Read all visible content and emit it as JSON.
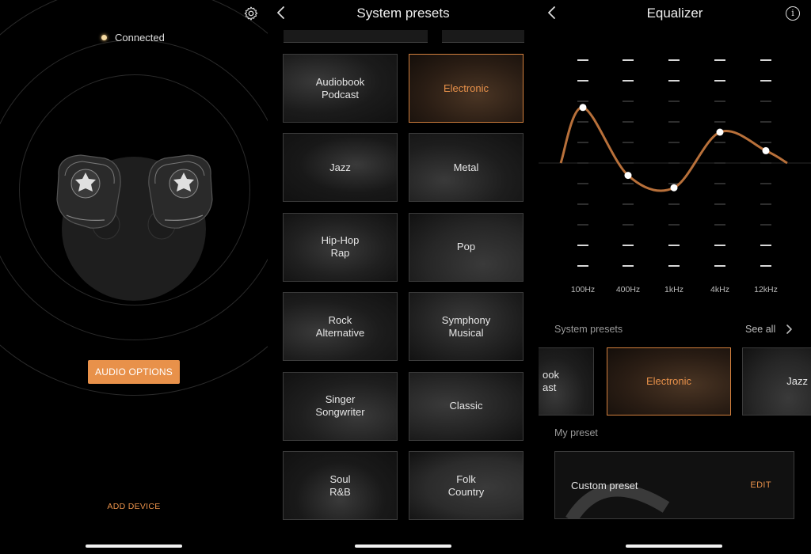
{
  "device": {
    "status": "Connected",
    "audio_options_label": "AUDIO OPTIONS",
    "add_device_label": "ADD DEVICE"
  },
  "presets_screen": {
    "title": "System presets",
    "presets": [
      {
        "label": "Audiobook\nPodcast",
        "selected": false
      },
      {
        "label": "Electronic",
        "selected": true
      },
      {
        "label": "Jazz",
        "selected": false
      },
      {
        "label": "Metal",
        "selected": false
      },
      {
        "label": "Hip-Hop\nRap",
        "selected": false
      },
      {
        "label": "Pop",
        "selected": false
      },
      {
        "label": "Rock\nAlternative",
        "selected": false
      },
      {
        "label": "Symphony\nMusical",
        "selected": false
      },
      {
        "label": "Singer\nSongwriter",
        "selected": false
      },
      {
        "label": "Classic",
        "selected": false
      },
      {
        "label": "Soul\nR&B",
        "selected": false
      },
      {
        "label": "Folk\nCountry",
        "selected": false
      }
    ]
  },
  "equalizer": {
    "title": "Equalizer",
    "bands": [
      {
        "freq": "100Hz",
        "level": 0.77
      },
      {
        "freq": "400Hz",
        "level": 0.44
      },
      {
        "freq": "1kHz",
        "level": 0.38
      },
      {
        "freq": "4kHz",
        "level": 0.65
      },
      {
        "freq": "12kHz",
        "level": 0.56
      }
    ],
    "system_presets_label": "System presets",
    "see_all_label": "See all",
    "carousel": [
      {
        "label": "ook\nast",
        "selected": false
      },
      {
        "label": "Electronic",
        "selected": true
      },
      {
        "label": "Jazz",
        "selected": false
      }
    ],
    "my_preset_label": "My preset",
    "custom_preset": {
      "name": "Custom preset",
      "edit_label": "EDIT"
    }
  },
  "colors": {
    "accent": "#e8914a",
    "curve": "#b8703a",
    "selected_border": "#d27f3d"
  }
}
